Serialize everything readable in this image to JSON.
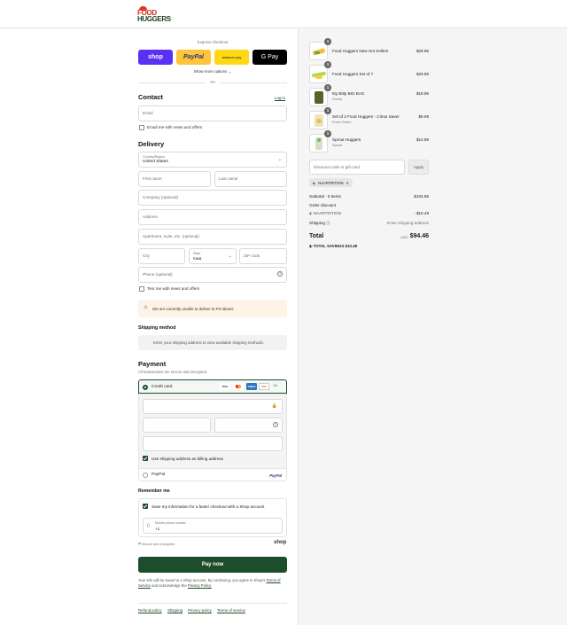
{
  "brand": {
    "line1": "FOOD",
    "line2": "HUGGERS"
  },
  "express": {
    "title": "Express checkout",
    "shop": "shop",
    "paypal": "PayPal",
    "amazon": "amazon pay",
    "gpay": "G Pay",
    "more": "Show more options",
    "or": "OR"
  },
  "contact": {
    "title": "Contact",
    "login": "Log in",
    "email_placeholder": "Email",
    "news": "Email me with news and offers"
  },
  "delivery": {
    "title": "Delivery",
    "country_label": "Country/Region",
    "country": "United States",
    "first": "First name",
    "last": "Last name",
    "company": "Company (optional)",
    "address": "Address",
    "apartment": "Apartment, suite, etc. (optional)",
    "city": "City",
    "state_label": "State",
    "state": "Iowa",
    "zip": "ZIP code",
    "phone": "Phone (optional)",
    "text_news": "Text me with news and offers",
    "warning": "We are currently unable to deliver to PO Boxes."
  },
  "shipping": {
    "title": "Shipping method",
    "message": "Enter your shipping address to view available shipping methods."
  },
  "payment": {
    "title": "Payment",
    "subtitle": "All transactions are secure and encrypted.",
    "credit_card": "Credit card",
    "more_cards": "+4",
    "billing": "Use shipping address as billing address",
    "paypal": "PayPal",
    "paypal_logo": "PayPal"
  },
  "remember": {
    "title": "Remember me",
    "save": "Save my information for a faster checkout with a Shop account",
    "phone_label": "Mobile phone number",
    "phone_value": "+1",
    "secure": "Secure and encrypted",
    "shop": "shop"
  },
  "pay_button": "Pay now",
  "legal": {
    "text1": "Your info will be saved to a Shop account. By continuing, you agree to Shop's",
    "tos": "Terms of Service",
    "text2": "and acknowledge the",
    "privacy": "Privacy Policy."
  },
  "footer": [
    "Refund policy",
    "Shipping",
    "Privacy policy",
    "Terms of service"
  ],
  "items": [
    {
      "qty": "1",
      "name": "Food Huggers New Hot Sellers",
      "variant": "",
      "price": "$29.99"
    },
    {
      "qty": "1",
      "name": "Food Huggers Set of 7",
      "variant": "",
      "price": "$29.99"
    },
    {
      "qty": "1",
      "name": "Itty Bitty BIG BAG",
      "variant": "Forest",
      "price": "$19.99"
    },
    {
      "qty": "1",
      "name": "Set of 2 Food Huggers - Citrus Saver",
      "variant": "Fresh Green",
      "price": "$9.99"
    },
    {
      "qty": "1",
      "name": "Sprout Huggers",
      "variant": "Sprout",
      "price": "$14.99"
    }
  ],
  "discount": {
    "placeholder": "Discount code or gift card",
    "apply": "Apply",
    "tag": "NAARTRITION"
  },
  "summary": {
    "subtotal_label": "Subtotal · 5 items",
    "subtotal": "$104.95",
    "order_discount": "Order discount",
    "code": "NAARTRITION",
    "code_amount": "- $10.49",
    "shipping_label": "Shipping",
    "shipping_value": "Enter shipping address",
    "total_label": "Total",
    "currency": "USD",
    "total": "$94.46",
    "savings_label": "TOTAL SAVINGS",
    "savings": "$10.49"
  },
  "colors": {
    "accent": "#1d4d2b",
    "shop_purple": "#5a31f4",
    "paypal_yellow": "#ffc439",
    "amazon_yellow": "#ffd814"
  }
}
